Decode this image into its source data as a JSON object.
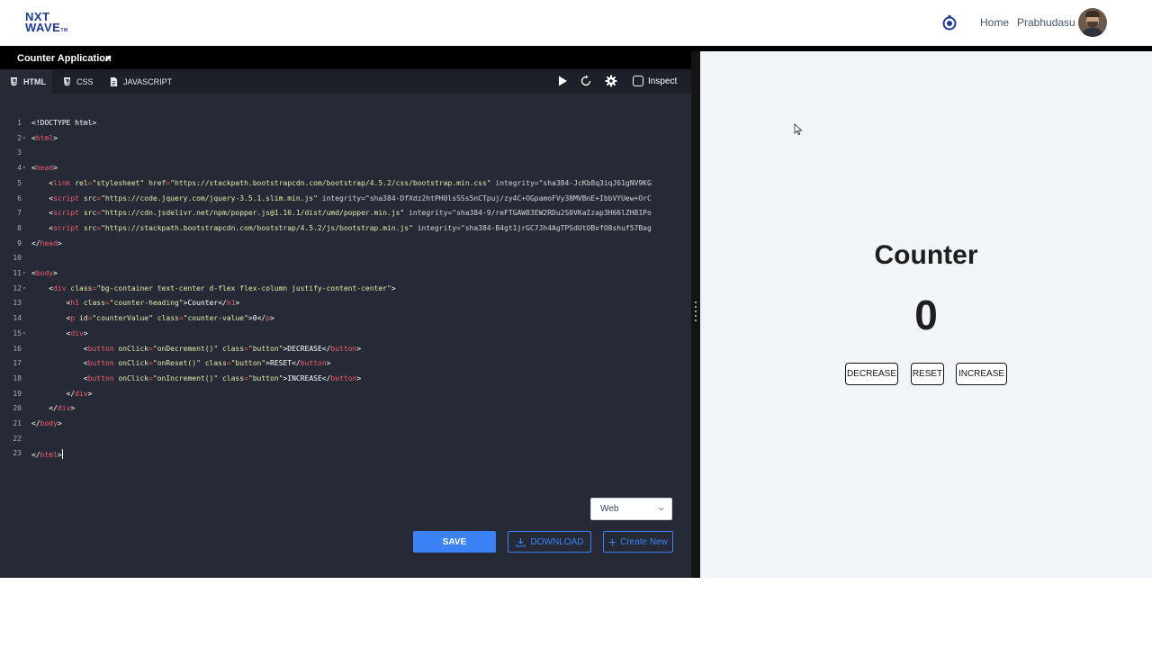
{
  "header": {
    "logo_line1": "NXT",
    "logo_line2": "WAVE",
    "logo_tm": "TM",
    "home": "Home",
    "user": "Prabhudasu",
    "brand_color": "#1f3a93"
  },
  "editor": {
    "title": "Counter Application",
    "tabs": [
      "HTML",
      "CSS",
      "JAVASCRIPT"
    ],
    "active_tab": "HTML",
    "inspect_label": "Inspect",
    "platform_value": "Web",
    "save_label": "SAVE",
    "download_label": "DOWNLOAD",
    "create_label": "Create New",
    "accent_color": "#3b82f6",
    "code_lines": [
      "<!DOCTYPE html>",
      "<html>",
      "",
      "<head>",
      "    <link rel=\"stylesheet\" href=\"https://stackpath.bootstrapcdn.com/bootstrap/4.5.2/css/bootstrap.min.css\" integrity=\"sha384-JcKb8q3iqJ61gNV9KG",
      "    <script src=\"https://code.jquery.com/jquery-3.5.1.slim.min.js\" integrity=\"sha384-DfXdz2htPH0lsSSs5nCTpuj/zy4C+OGpamoFVy38MVBnE+IbbVYUew+OrC",
      "    <script src=\"https://cdn.jsdelivr.net/npm/popper.js@1.16.1/dist/umd/popper.min.js\" integrity=\"sha384-9/reFTGAW83EW2RDu2S0VKaIzap3H66lZH81Po",
      "    <script src=\"https://stackpath.bootstrapcdn.com/bootstrap/4.5.2/js/bootstrap.min.js\" integrity=\"sha384-B4gt1jrGC7Jh4AgTPSdUtOBvfO8shuf57Bag",
      "</head>",
      "",
      "<body>",
      "    <div class=\"bg-container text-center d-flex flex-column justify-content-center\">",
      "        <h1 class=\"counter-heading\">Counter</h1>",
      "        <p id=\"counterValue\" class=\"counter-value\">0</p>",
      "        <div>",
      "            <button onClick=\"onDecrement()\" class=\"button\">DECREASE</button>",
      "            <button onClick=\"onReset()\" class=\"button\">RESET</button>",
      "            <button onClick=\"onIncrement()\" class=\"button\">INCREASE</button>",
      "        </div>",
      "    </div>",
      "</body>",
      "",
      "</html>"
    ]
  },
  "preview": {
    "heading": "Counter",
    "value": "0",
    "buttons": [
      "DECREASE",
      "RESET",
      "INCREASE"
    ]
  }
}
